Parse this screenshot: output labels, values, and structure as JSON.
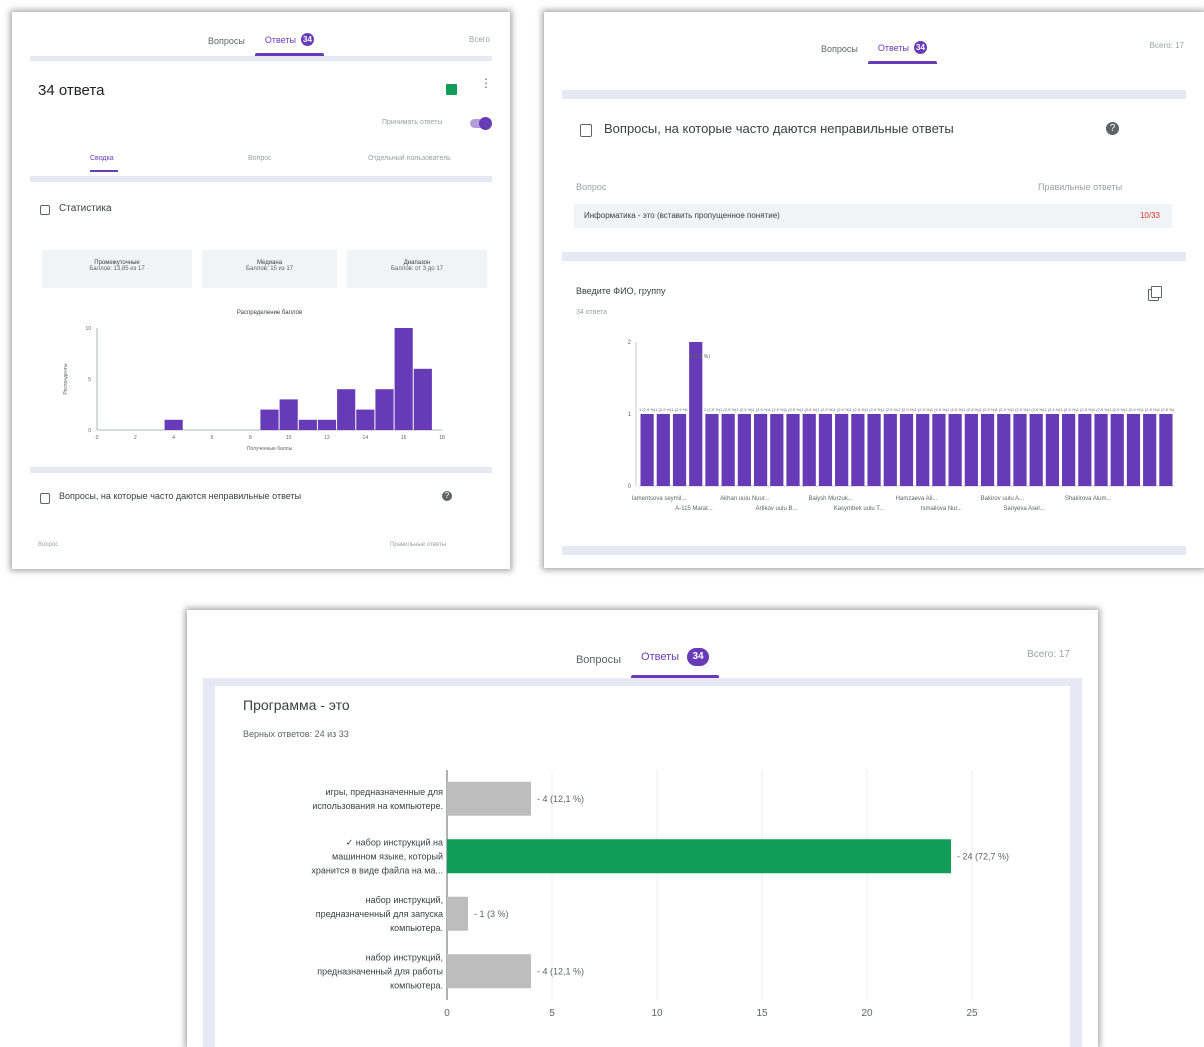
{
  "screen1": {
    "tabs": {
      "questions": "Вопросы",
      "answers": "Ответы",
      "answers_count": "34",
      "total": "Всего"
    },
    "title": "34 ответа",
    "accept_label": "Принимать ответы",
    "subtabs": [
      "Сводка",
      "Вопрос",
      "Отдельный пользователь"
    ],
    "stats_title": "Статистика",
    "stat_cards": [
      {
        "label": "Промежуточные",
        "value": "Баллов: 13,85 из 17"
      },
      {
        "label": "Медиана",
        "value": "Баллов: 15 из 17"
      },
      {
        "label": "Диапазон",
        "value": "Баллов: от 3 до 17"
      }
    ],
    "wrong_title": "Вопросы, на которые часто даются неправильные ответы",
    "question_col": "Вопрос",
    "correct_col": "Правильные ответы"
  },
  "screen2": {
    "tabs": {
      "questions": "Вопросы",
      "answers": "Ответы",
      "answers_count": "34",
      "total": "Всего: 17"
    },
    "wrong_title": "Вопросы, на которые часто даются неправильные ответы",
    "question_col": "Вопрос",
    "correct_col": "Правильные ответы",
    "row_question": "Информатика - это (вставить пропущенное понятие)",
    "row_score": "10/33",
    "card_title": "Введите ФИО, группу",
    "card_count": "34 ответа",
    "peak_label": "2 (5,9 %)",
    "name_labels_top": [
      "Iamentsova seymil...",
      "Akhan uulu Nuur...",
      "Baiysh Murzuk...",
      "Hamzaeva Ali...",
      "Bakirov uulu A...",
      "Shakirova Alum..."
    ],
    "name_labels_bottom": [
      "A-115 Marat...",
      "Artikov uulu B...",
      "Kasymbek uulu T...",
      "Ismailova Nur...",
      "Sariyeva Asel..."
    ]
  },
  "screen3": {
    "tabs": {
      "questions": "Вопросы",
      "answers": "Ответы",
      "answers_count": "34",
      "total": "Всего: 17"
    },
    "question": "Программа - это",
    "correct_summary": "Верных ответов: 24 из 33"
  },
  "chart_data": [
    {
      "type": "bar",
      "title": "Распределение баллов",
      "xlabel": "Полученные баллы",
      "ylabel": "Респонденты",
      "x": [
        3,
        4,
        8,
        9,
        10,
        11,
        12,
        13,
        14,
        15,
        16,
        17
      ],
      "values": [
        0,
        1,
        0,
        2,
        3,
        1,
        1,
        4,
        2,
        4,
        10,
        6
      ],
      "xlim": [
        0,
        18
      ],
      "ylim": [
        0,
        10
      ],
      "x_ticks": [
        "0",
        "2",
        "4",
        "6",
        "8",
        "10",
        "12",
        "14",
        "16",
        "18"
      ],
      "y_ticks": [
        "0",
        "5",
        "10"
      ],
      "color": "#673ab7"
    },
    {
      "type": "bar",
      "title": "",
      "categories_count": 33,
      "values": [
        1,
        1,
        1,
        2,
        1,
        1,
        1,
        1,
        1,
        1,
        1,
        1,
        1,
        1,
        1,
        1,
        1,
        1,
        1,
        1,
        1,
        1,
        1,
        1,
        1,
        1,
        1,
        1,
        1,
        1,
        1,
        1,
        1
      ],
      "ylim": [
        0,
        2
      ],
      "y_ticks": [
        "0",
        "1",
        "2"
      ],
      "bar_label": "1 (2,9 %)",
      "color": "#673ab7"
    },
    {
      "type": "bar",
      "orientation": "horizontal",
      "title": "",
      "categories": [
        "игры, предназначенные для использования на компьютере.",
        "✓ набор инструкций на машинном языке, который хранится в виде файла на ма...",
        "набор инструкций, предназначенный для запуска компьютера.",
        "набор инструкций, предназначенный для работы компьютера."
      ],
      "values": [
        4,
        24,
        1,
        4
      ],
      "value_labels": [
        "4 (12,1 %)",
        "24 (72,7 %)",
        "1 (3 %)",
        "4 (12,1 %)"
      ],
      "correct_index": 1,
      "xlim": [
        0,
        25
      ],
      "x_ticks": [
        "0",
        "5",
        "10",
        "15",
        "20",
        "25"
      ],
      "colors": {
        "correct": "#0f9d58",
        "other": "#bdbdbd"
      }
    }
  ],
  "colors": {
    "accent": "#673ab7",
    "correct": "#0f9d58",
    "wrong": "#d93025",
    "sheets": "#0f9d58"
  }
}
